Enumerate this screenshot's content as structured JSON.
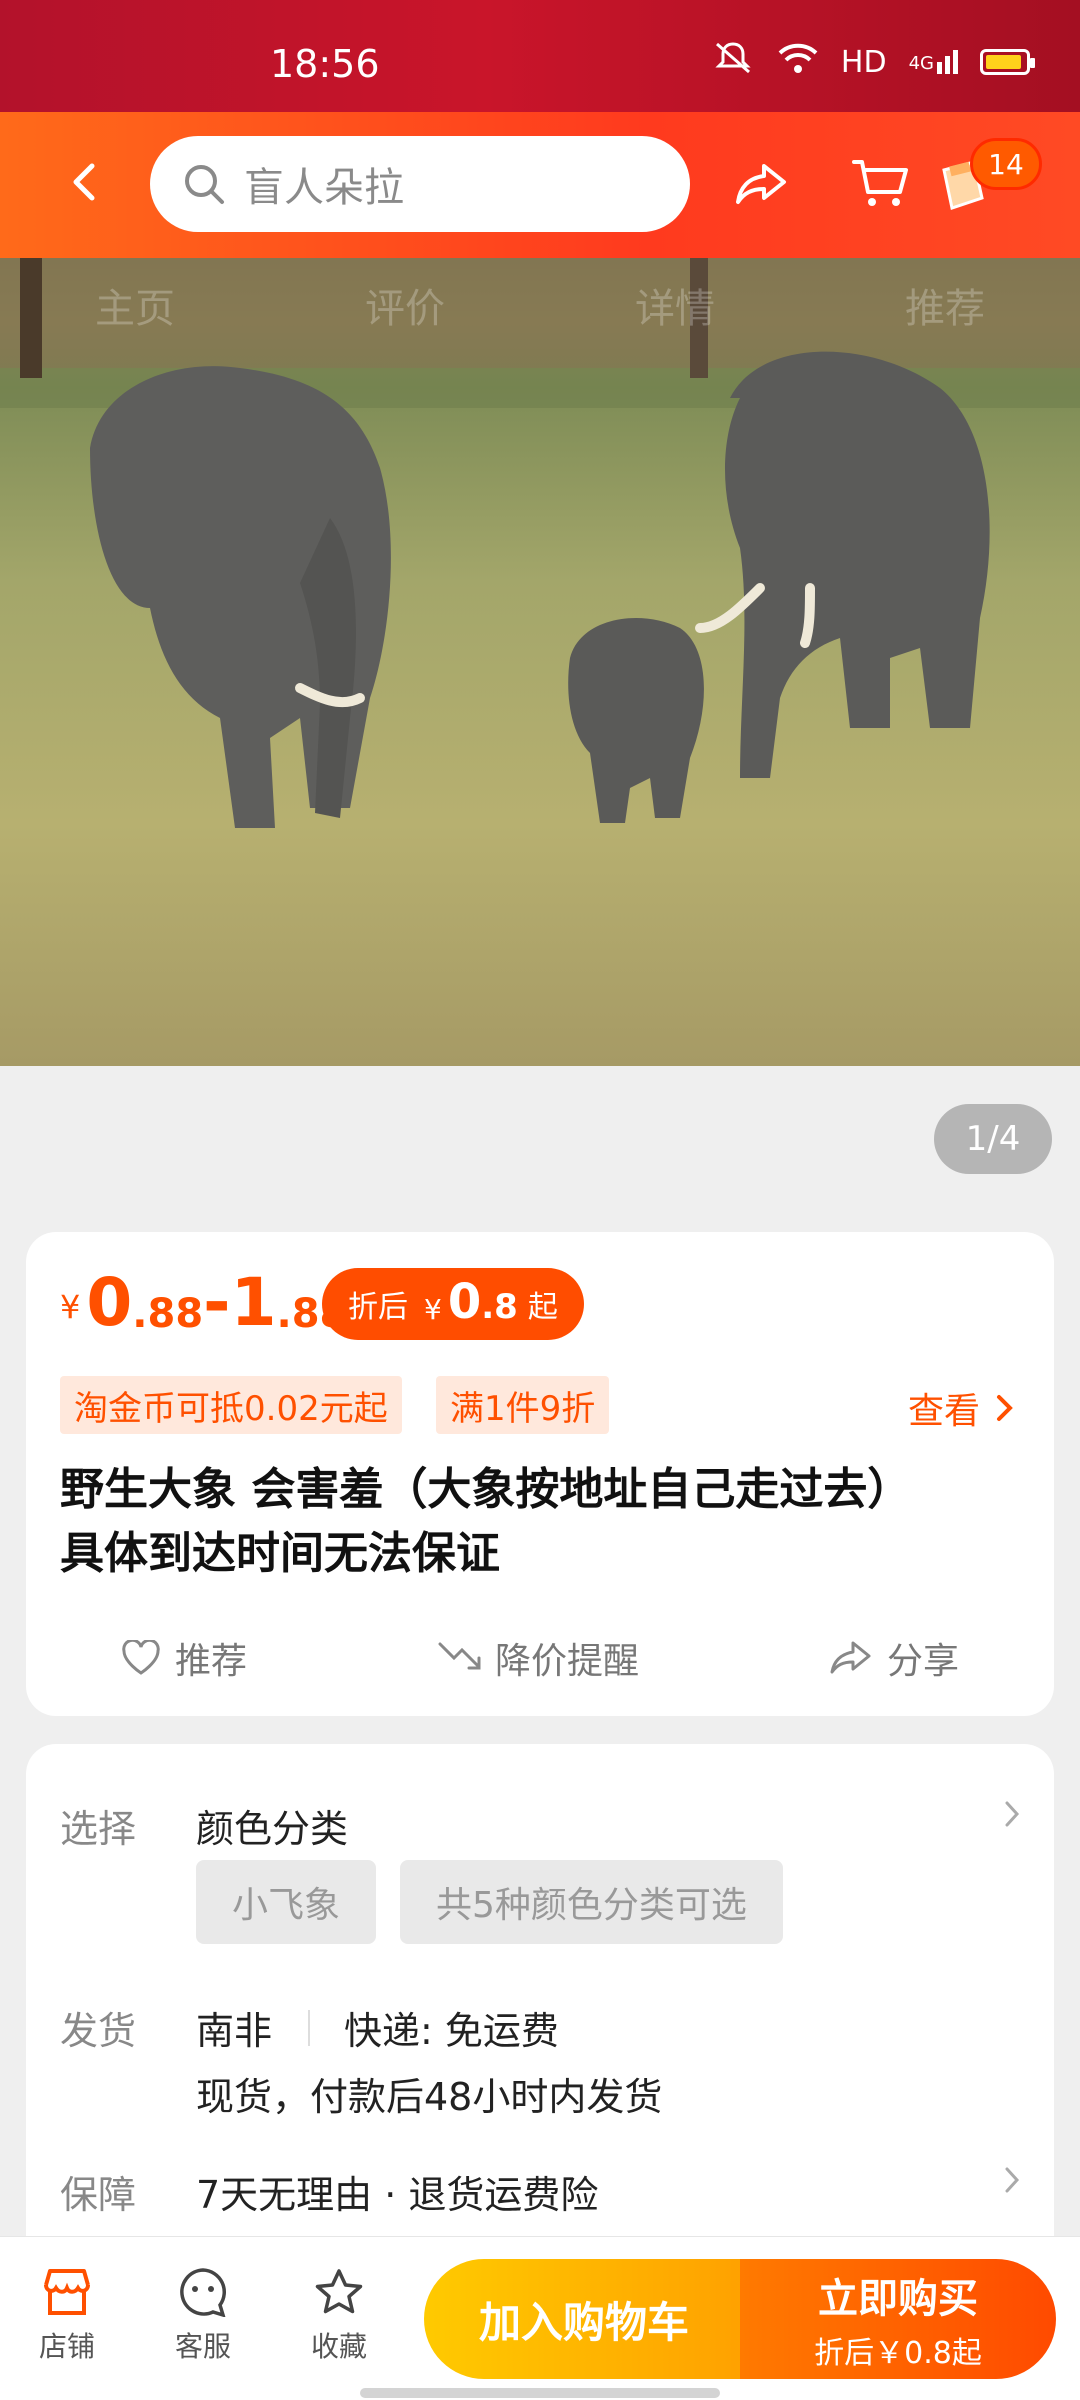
{
  "status": {
    "time": "18:56",
    "network": "HD",
    "signal": "4G"
  },
  "header": {
    "search_placeholder": "盲人朵拉",
    "cart_count": "14"
  },
  "image_tabs": [
    "主页",
    "评价",
    "详情",
    "推荐"
  ],
  "image_counter": "1/4",
  "price": {
    "yen": "¥",
    "low_int": "0",
    "low_dec": ".88",
    "dash": "-",
    "high_int": "1",
    "high_dec": ".88",
    "discount_label": "折后",
    "discount_yen": "¥",
    "discount_int": "0",
    "discount_dec": ".8",
    "discount_suffix": "起"
  },
  "promos": {
    "coin": "淘金币可抵0.02元起",
    "deal": "满1件9折",
    "see": "查看"
  },
  "product": {
    "title_line1": "野生大象 会害羞（大象按地址自己走过去）",
    "title_line2": "具体到达时间无法保证"
  },
  "actions": {
    "recommend": "推荐",
    "price_alert": "降价提醒",
    "share": "分享"
  },
  "options": {
    "select_label": "选择",
    "select_value": "颜色分类",
    "chip1": "小飞象",
    "chip2": "共5种颜色分类可选",
    "ship_label": "发货",
    "ship_from": "南非",
    "ship_method": "快递: 免运费",
    "ship_time": "现货，付款后48小时内发货",
    "guarantee_label": "保障",
    "guarantee_value": "7天无理由 · 退货运费险"
  },
  "bottom": {
    "shop": "店铺",
    "service": "客服",
    "favorite": "收藏",
    "add_cart": "加入购物车",
    "buy_now": "立即购买",
    "buy_sub": "折后￥0.8起"
  },
  "colors": {
    "accent": "#ff5000",
    "header": "#ff4a1e",
    "statusbar": "#c9152a"
  }
}
